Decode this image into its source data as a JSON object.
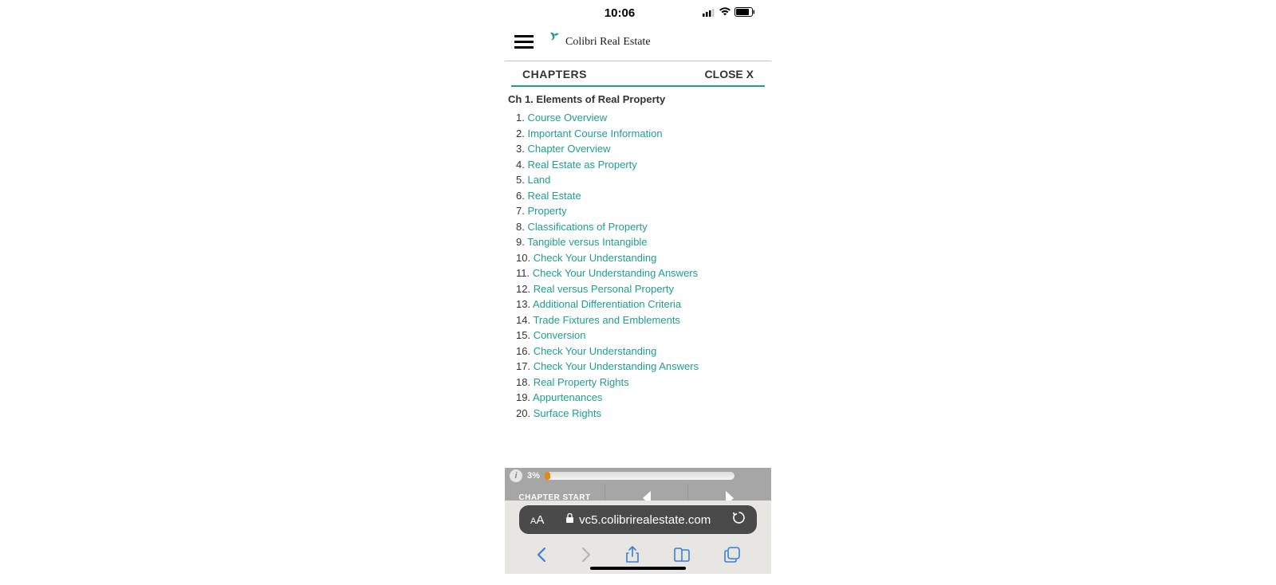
{
  "status": {
    "time": "10:06"
  },
  "header": {
    "brand": "Colibri Real Estate"
  },
  "chapters_bar": {
    "label": "CHAPTERS",
    "close": "CLOSE X"
  },
  "chapter": {
    "title": "Ch 1. Elements of Real Property",
    "lessons": [
      {
        "num": "1.",
        "label": "Course Overview"
      },
      {
        "num": "2.",
        "label": "Important Course Information"
      },
      {
        "num": "3.",
        "label": "Chapter Overview"
      },
      {
        "num": "4.",
        "label": "Real Estate as Property"
      },
      {
        "num": "5.",
        "label": "Land"
      },
      {
        "num": "6.",
        "label": "Real Estate"
      },
      {
        "num": "7.",
        "label": "Property"
      },
      {
        "num": "8.",
        "label": "Classifications of Property"
      },
      {
        "num": "9.",
        "label": "Tangible versus Intangible"
      },
      {
        "num": "10.",
        "label": "Check Your Understanding"
      },
      {
        "num": "11.",
        "label": "Check Your Understanding Answers"
      },
      {
        "num": "12.",
        "label": "Real versus Personal Property"
      },
      {
        "num": "13.",
        "label": "Additional Differentiation Criteria"
      },
      {
        "num": "14.",
        "label": "Trade Fixtures and Emblements"
      },
      {
        "num": "15.",
        "label": "Conversion"
      },
      {
        "num": "16.",
        "label": "Check Your Understanding"
      },
      {
        "num": "17.",
        "label": "Check Your Understanding Answers"
      },
      {
        "num": "18.",
        "label": "Real Property Rights"
      },
      {
        "num": "19.",
        "label": "Appurtenances"
      },
      {
        "num": "20.",
        "label": "Surface Rights"
      }
    ]
  },
  "progress": {
    "percent": "3%",
    "value": 3
  },
  "nav": {
    "chapter_start": "CHAPTER START"
  },
  "urlbar": {
    "aa": "AA",
    "url": "vc5.colibrirealestate.com"
  }
}
